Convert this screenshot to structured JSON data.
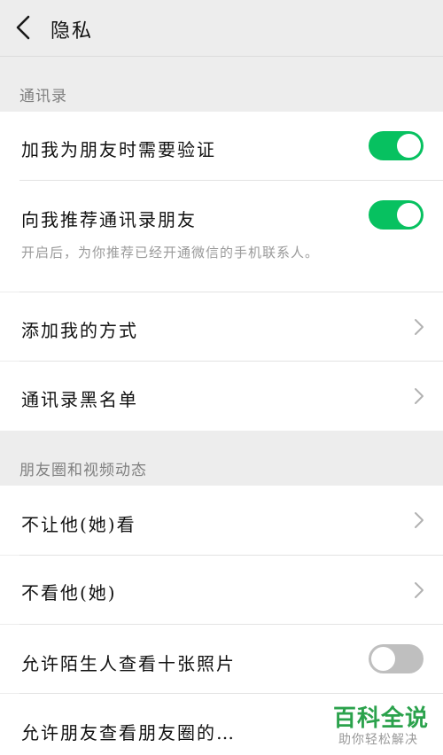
{
  "header": {
    "title": "隐私",
    "back_icon": "chevron-left-icon"
  },
  "sections": [
    {
      "title": "通讯录",
      "rows": [
        {
          "label": "加我为朋友时需要验证",
          "control": "toggle",
          "enabled": true
        },
        {
          "label": "向我推荐通讯录朋友",
          "control": "toggle",
          "enabled": true,
          "description": "开启后，为你推荐已经开通微信的手机联系人。"
        },
        {
          "label": "添加我的方式",
          "control": "chevron"
        },
        {
          "label": "通讯录黑名单",
          "control": "chevron"
        }
      ]
    },
    {
      "title": "朋友圈和视频动态",
      "rows": [
        {
          "label": "不让他(她)看",
          "control": "chevron"
        },
        {
          "label": "不看他(她)",
          "control": "chevron"
        },
        {
          "label": "允许陌生人查看十张照片",
          "control": "toggle",
          "enabled": false
        },
        {
          "label": "允许朋友查看朋友圈的…",
          "control": "none"
        }
      ]
    }
  ],
  "watermark": {
    "logo_text": "百科全说",
    "subtitle": "助你轻松解决"
  },
  "colors": {
    "toggle_on": "#07c160",
    "toggle_off": "#bfbfbf",
    "background": "#ededed",
    "watermark": "#2ba24c"
  }
}
